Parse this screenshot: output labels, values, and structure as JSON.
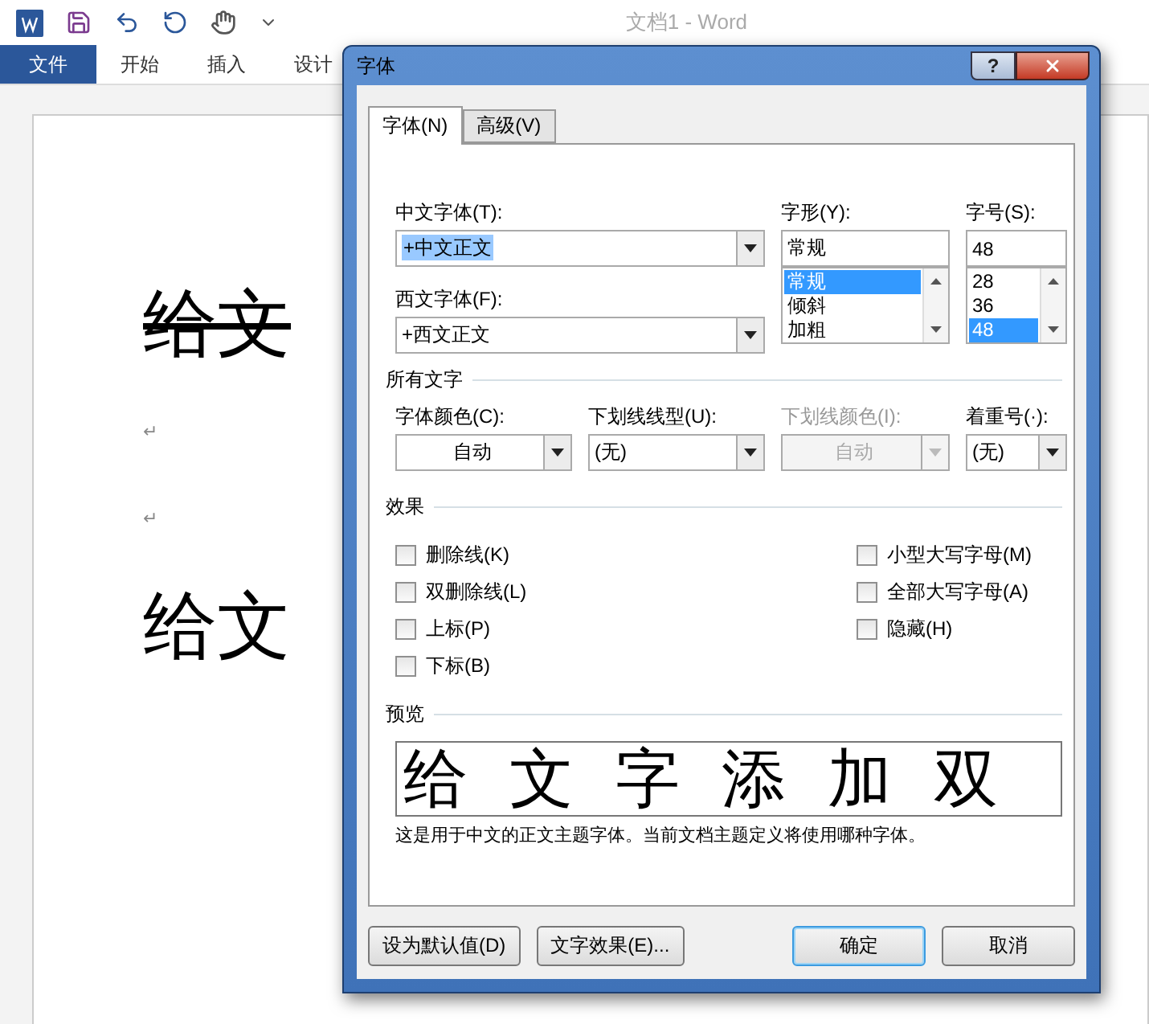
{
  "app": {
    "title": "文档1 - Word",
    "ribbon_tabs": [
      {
        "label": "文件",
        "selected": true
      },
      {
        "label": "开始",
        "selected": false
      },
      {
        "label": "插入",
        "selected": false
      },
      {
        "label": "设计",
        "selected": false
      }
    ]
  },
  "document": {
    "lines": [
      {
        "kind": "text",
        "text": "给文",
        "strikethrough": true
      },
      {
        "kind": "mark",
        "text": "↵"
      },
      {
        "kind": "mark",
        "text": "↵"
      },
      {
        "kind": "text",
        "text": "给文",
        "strikethrough": false
      }
    ]
  },
  "dialog": {
    "title": "字体",
    "help": "?",
    "tabs": [
      {
        "label": "字体(N)",
        "selected": true
      },
      {
        "label": "高级(V)",
        "selected": false
      }
    ],
    "chinese_font": {
      "label": "中文字体(T):",
      "value": "+中文正文"
    },
    "western_font": {
      "label": "西文字体(F):",
      "value": "+西文正文"
    },
    "style": {
      "label": "字形(Y):",
      "value": "常规",
      "options": [
        {
          "label": "常规",
          "selected": true
        },
        {
          "label": "倾斜",
          "selected": false
        },
        {
          "label": "加粗",
          "selected": false
        }
      ]
    },
    "size": {
      "label": "字号(S):",
      "value": "48",
      "options": [
        {
          "label": "28",
          "selected": false
        },
        {
          "label": "36",
          "selected": false
        },
        {
          "label": "48",
          "selected": true
        }
      ]
    },
    "all_text": {
      "heading": "所有文字",
      "fields": [
        {
          "label": "字体颜色(C):",
          "value": "自动",
          "disabled": false
        },
        {
          "label": "下划线线型(U):",
          "value": "(无)",
          "disabled": false
        },
        {
          "label": "下划线颜色(I):",
          "value": "自动",
          "disabled": true
        },
        {
          "label": "着重号(·):",
          "value": "(无)",
          "disabled": false
        }
      ]
    },
    "effects": {
      "heading": "效果",
      "left": [
        {
          "label": "删除线(K)",
          "checked": false
        },
        {
          "label": "双删除线(L)",
          "checked": false
        },
        {
          "label": "上标(P)",
          "checked": false
        },
        {
          "label": "下标(B)",
          "checked": false
        }
      ],
      "right": [
        {
          "label": "小型大写字母(M)",
          "checked": false
        },
        {
          "label": "全部大写字母(A)",
          "checked": false
        },
        {
          "label": "隐藏(H)",
          "checked": false
        }
      ]
    },
    "preview": {
      "heading": "预览",
      "sample": "给文字添加双",
      "description": "这是用于中文的正文主题字体。当前文档主题定义将使用哪种字体。"
    },
    "buttons": [
      {
        "label": "设为默认值(D)",
        "kind": "secondary"
      },
      {
        "label": "文字效果(E)...",
        "kind": "secondary"
      },
      {
        "label": "确定",
        "kind": "default"
      },
      {
        "label": "取消",
        "kind": "normal"
      }
    ]
  }
}
